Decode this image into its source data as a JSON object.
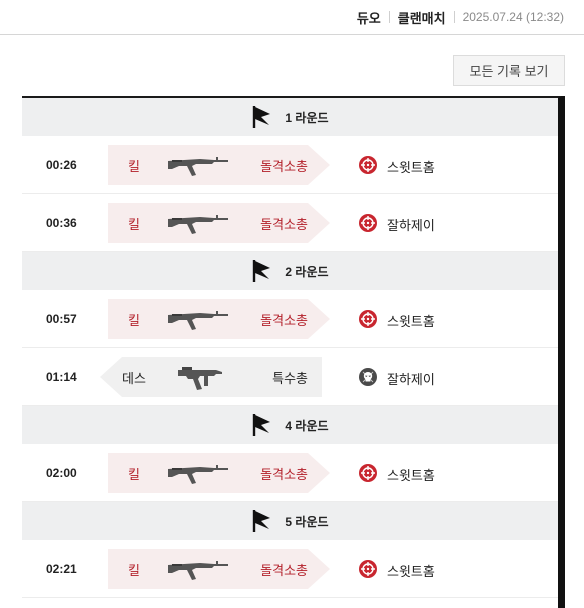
{
  "header": {
    "mode": "듀오",
    "match_type": "클랜매치",
    "date": "2025.07.24 (12:32)"
  },
  "actions": {
    "all_records_label": "모든 기록 보기"
  },
  "colors": {
    "kill_accent": "#b3202a",
    "kill_plate_bg": "#f7eded",
    "death_plate_bg": "#f0f0f0",
    "round_header_bg": "#eeeff0"
  },
  "timeline": {
    "rounds": [
      {
        "label": "1 라운드",
        "events": [
          {
            "time": "00:26",
            "type": "킬",
            "weapon_icon": "assault-rifle-icon",
            "weapon_class": "돌격소총",
            "target_icon": "crosshair-icon",
            "player": "스윗트홈"
          },
          {
            "time": "00:36",
            "type": "킬",
            "weapon_icon": "assault-rifle-icon",
            "weapon_class": "돌격소총",
            "target_icon": "crosshair-icon",
            "player": "잘하제이"
          }
        ]
      },
      {
        "label": "2 라운드",
        "events": [
          {
            "time": "00:57",
            "type": "킬",
            "weapon_icon": "assault-rifle-icon",
            "weapon_class": "돌격소총",
            "target_icon": "crosshair-icon",
            "player": "스윗트홈"
          },
          {
            "time": "01:14",
            "type": "데스",
            "weapon_icon": "submachine-gun-icon",
            "weapon_class": "특수총",
            "target_icon": "skull-icon",
            "player": "잘하제이"
          }
        ]
      },
      {
        "label": "4 라운드",
        "events": [
          {
            "time": "02:00",
            "type": "킬",
            "weapon_icon": "assault-rifle-icon",
            "weapon_class": "돌격소총",
            "target_icon": "crosshair-icon",
            "player": "스윗트홈"
          }
        ]
      },
      {
        "label": "5 라운드",
        "events": [
          {
            "time": "02:21",
            "type": "킬",
            "weapon_icon": "assault-rifle-icon",
            "weapon_class": "돌격소총",
            "target_icon": "crosshair-icon",
            "player": "스윗트홈"
          }
        ]
      }
    ]
  }
}
